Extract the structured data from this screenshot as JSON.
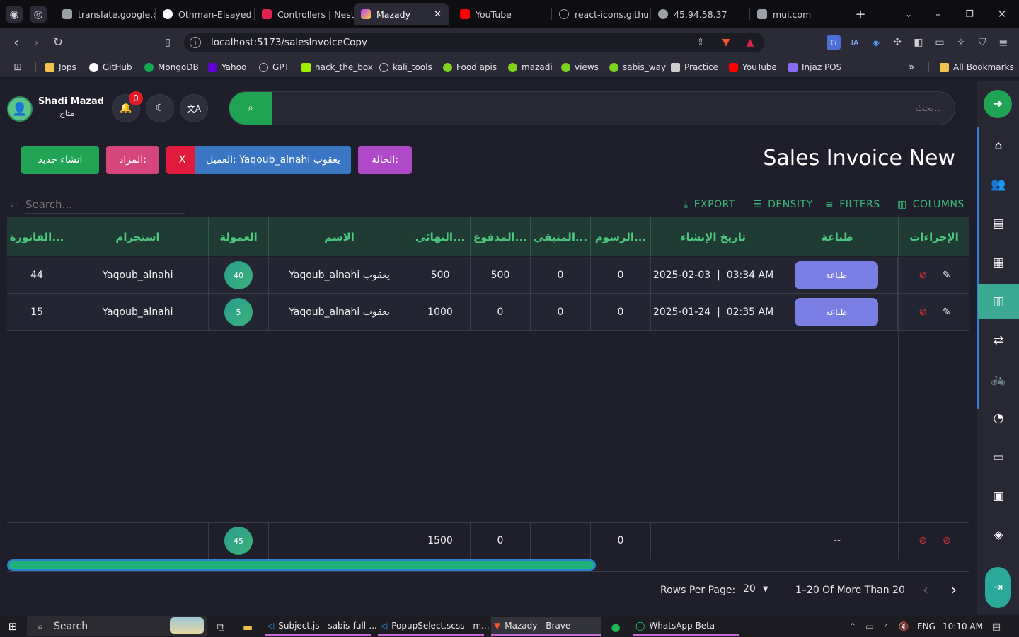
{
  "browser": {
    "tabs": [
      {
        "label": "translate.google.c",
        "icon": "translate-icon"
      },
      {
        "label": "Othman-Elsayed",
        "icon": "github-icon"
      },
      {
        "label": "Controllers | Nest",
        "icon": "nestjs-icon"
      },
      {
        "label": "Mazady",
        "icon": "vite-icon",
        "active": true
      },
      {
        "label": "YouTube",
        "icon": "youtube-icon"
      },
      {
        "label": "react-icons.githu",
        "icon": "react-icon"
      },
      {
        "label": "45.94.58.37",
        "icon": "globe-icon"
      },
      {
        "label": "mui.com",
        "icon": "mui-icon"
      }
    ],
    "url": "localhost:5173/salesInvoiceCopy",
    "bookmarks": [
      "Jops",
      "GitHub",
      "MongoDB",
      "Yahoo",
      "GPT",
      "hack_the_box",
      "kali_tools",
      "Food apis",
      "mazadi",
      "views",
      "sabis_way",
      "Practice",
      "YouTube",
      "Injaz POS"
    ],
    "all_bookmarks": "All Bookmarks",
    "more": "»"
  },
  "header": {
    "user_name": "Shadi Mazad",
    "user_status": "متاح",
    "notification_count": "0",
    "search_placeholder": "بحث..",
    "search_icon": "⌕"
  },
  "page": {
    "title": "Sales Invoice New",
    "chips": {
      "create": "انشاء جديد",
      "auction": "المزاد:",
      "clear": "X",
      "customer": "العميل: Yaqoub_alnahi يعقوب",
      "status": "الحالة:"
    }
  },
  "toolbar": {
    "search_placeholder": "Search…",
    "export": "EXPORT",
    "density": "DENSITY",
    "filters": "FILTERS",
    "columns": "COLUMNS"
  },
  "table": {
    "headers": [
      "الفاتورة...",
      "استجرام",
      "العمولة",
      "الاسم",
      "النهائي...",
      "المدفوع...",
      "المتبقي...",
      "الرسوم...",
      "تاريخ الإنشاء",
      "طباعة",
      "الإجراءات"
    ],
    "print_label": "طباعة",
    "rows": [
      {
        "invoice": "44",
        "user": "Yaqoub_alnahi",
        "commission": "40",
        "name": "Yaqoub_alnahi يعقوب",
        "final": "500",
        "paid": "500",
        "remaining": "0",
        "fees": "0",
        "date": "2025-02-03  |  03:34 AM"
      },
      {
        "invoice": "15",
        "user": "Yaqoub_alnahi",
        "commission": "5",
        "name": "Yaqoub_alnahi يعقوب",
        "final": "1000",
        "paid": "0",
        "remaining": "0",
        "fees": "0",
        "date": "2025-01-24  |  02:35 AM"
      }
    ],
    "footer": {
      "commission": "45",
      "final": "1500",
      "paid": "0",
      "fees": "0",
      "print": "--"
    }
  },
  "pagination": {
    "rows_per_page_label": "Rows Per Page:",
    "rows_per_page": "20",
    "range": "1–20 Of More Than 20"
  },
  "taskbar": {
    "search": "Search",
    "apps": [
      "Subject.js - sabis-full-...",
      "PopupSelect.scss - m...",
      "Mazady - Brave",
      "WhatsApp Beta"
    ],
    "lang": "ENG",
    "time": "10:10 AM"
  }
}
